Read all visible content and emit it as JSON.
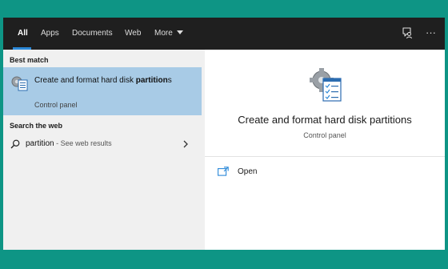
{
  "tabs": [
    {
      "label": "All",
      "active": true
    },
    {
      "label": "Apps"
    },
    {
      "label": "Documents"
    },
    {
      "label": "Web"
    },
    {
      "label": "More"
    }
  ],
  "icons": {
    "feedback": "feedback-icon",
    "more_options": "ellipsis-icon",
    "control_panel": "control-panel-icon",
    "search": "search-icon",
    "chevron": "chevron-right-icon",
    "open": "open-icon"
  },
  "colors": {
    "accent": "#2b88d8",
    "selected_bg": "#a8cbe6",
    "topbar_bg": "#1f1f1f",
    "desktop_bg": "#0e9585"
  },
  "best_match": {
    "heading": "Best match",
    "title_part1": "Create and format hard disk ",
    "title_bold": "partition",
    "title_part2": "s",
    "subtitle": "Control panel"
  },
  "web": {
    "heading": "Search the web",
    "query": "partition",
    "suffix": " - See web results"
  },
  "detail": {
    "title": "Create and format hard disk partitions",
    "subtitle": "Control panel",
    "actions": [
      {
        "label": "Open"
      }
    ]
  },
  "more_options_label": "···"
}
